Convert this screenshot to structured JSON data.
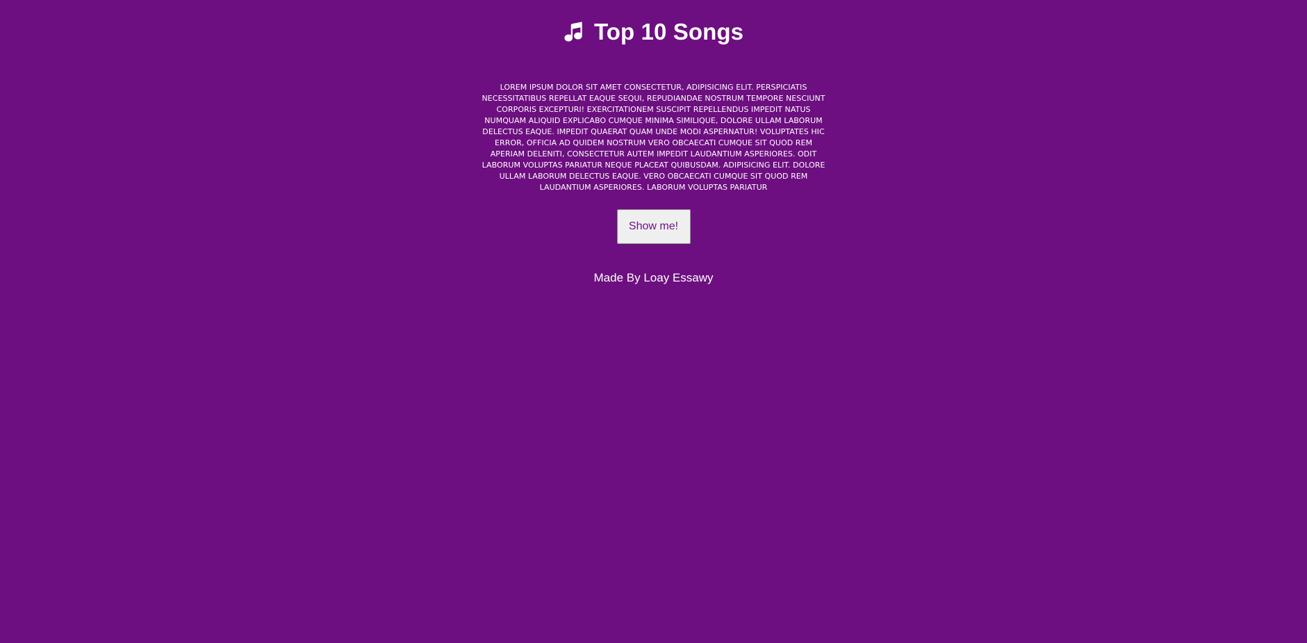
{
  "header": {
    "title": "Top 10 Songs",
    "icon": "music-note-icon"
  },
  "intro": {
    "text": "LOREM IPSUM DOLOR SIT AMET CONSECTETUR, ADIPISICING ELIT. PERSPICIATIS NECESSITATIBUS REPELLAT EAQUE SEQUI, REPUDIANDAE NOSTRUM TEMPORE NESCIUNT CORPORIS EXCEPTURI! EXERCITATIONEM SUSCIPIT REPELLENDUS IMPEDIT NATUS NUMQUAM ALIQUID EXPLICABO CUMQUE MINIMA SIMILIQUE, DOLORE ULLAM LABORUM DELECTUS EAQUE. IMPEDIT QUAERAT QUAM UNDE MODI ASPERNATUR! VOLUPTATES HIC ERROR, OFFICIA AD QUIDEM NOSTRUM VERO OBCAECATI CUMQUE SIT QUOD REM APERIAM DELENITI, CONSECTETUR AUTEM IMPEDIT LAUDANTIUM ASPERIORES. ODIT LABORUM VOLUPTAS PARIATUR NEQUE PLACEAT QUIBUSDAM. ADIPISICING ELIT. DOLORE ULLAM LABORUM DELECTUS EAQUE. VERO OBCAECATI CUMQUE SIT QUOD REM LAUDANTIUM ASPERIORES. LABORUM VOLUPTAS PARIATUR"
  },
  "actions": {
    "show_label": "Show me!"
  },
  "footer": {
    "credit": "Made By Loay Essawy"
  },
  "colors": {
    "background": "#6d0f80",
    "text": "#ffffff",
    "button_bg": "#efeff0",
    "button_text": "#6b1582"
  }
}
